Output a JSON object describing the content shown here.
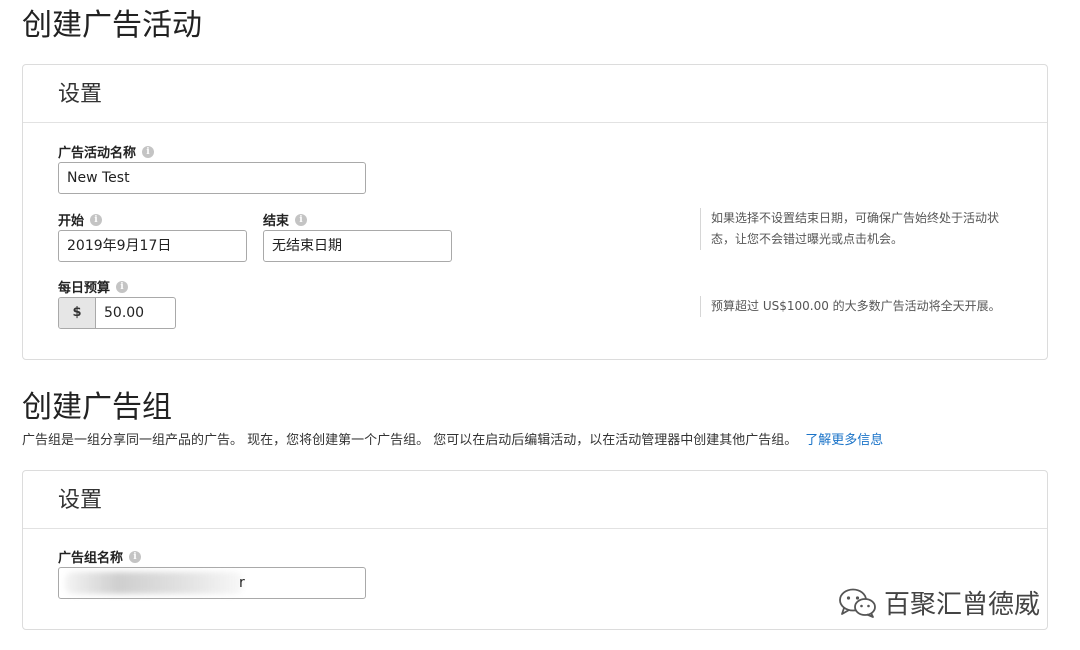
{
  "campaign": {
    "title": "创建广告活动",
    "settings_header": "设置",
    "name_label": "广告活动名称",
    "name_value": "New Test",
    "start_label": "开始",
    "start_value": "2019年9月17日",
    "end_label": "结束",
    "end_value": "无结束日期",
    "end_hint": "如果选择不设置结束日期，可确保广告始终处于活动状态，让您不会错过曝光或点击机会。",
    "budget_label": "每日预算",
    "budget_currency": "$",
    "budget_value": "50.00",
    "budget_hint": "预算超过 US$100.00 的大多数广告活动将全天开展。"
  },
  "ad_group": {
    "title": "创建广告组",
    "description": "广告组是一组分享同一组产品的广告。 现在，您将创建第一个广告组。 您可以在启动后编辑活动，以在活动管理器中创建其他广告组。",
    "learn_more": "了解更多信息",
    "settings_header": "设置",
    "name_label": "广告组名称",
    "name_value_visible_tail": "r"
  },
  "watermark": {
    "text": "百聚汇曾德威",
    "icon": "wechat-icon"
  },
  "colors": {
    "link": "#1a73c8",
    "border": "#dcdcdc",
    "prefix_bg": "#e6e6e6"
  }
}
